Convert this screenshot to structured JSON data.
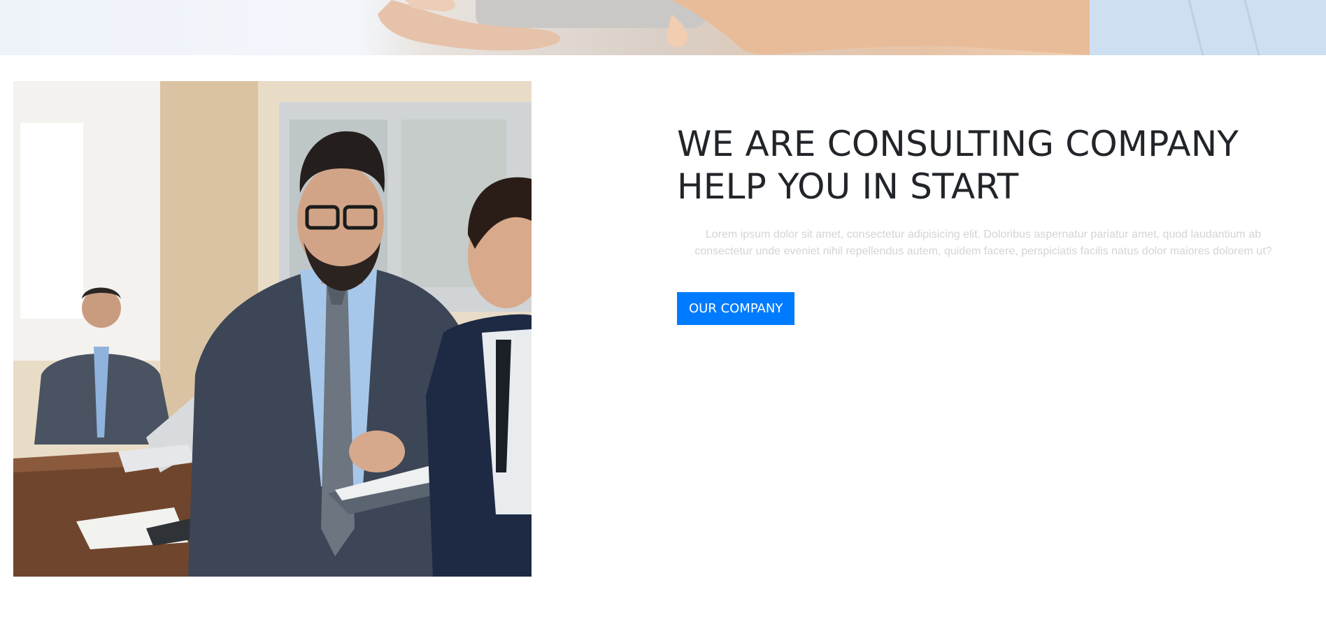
{
  "hero_strip": {
    "image": "hands-holding-tablet-photo"
  },
  "photo": {
    "image": "businessmen-reviewing-clipboard-photo"
  },
  "content": {
    "headline": "WE ARE CONSULTING COMPANY HELP YOU IN START",
    "lead": "Lorem ipsum dolor sit amet, consectetur adipisicing elit. Doloribus aspernatur pariatur amet, quod laudantium ab consectetur unde eveniet nihil repellendus autem, quidem facere, perspiciatis facilis natus dolor maiores dolorem ut?",
    "cta_label": "OUR COMPANY"
  },
  "colors": {
    "accent": "#007bff",
    "heading": "#212529",
    "muted_text": "#d2d4d6"
  }
}
